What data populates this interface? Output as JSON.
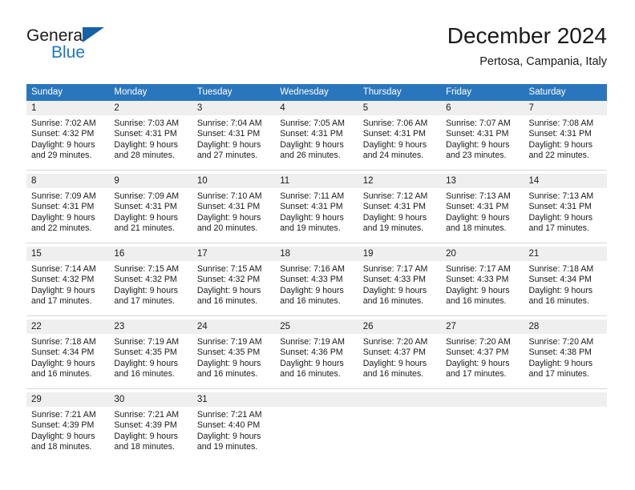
{
  "brand": {
    "line1": "General",
    "line2": "Blue",
    "triangle_icon": "brand-triangle-icon",
    "color_dark": "#1a1a1a",
    "color_blue": "#1f77c4"
  },
  "header": {
    "title": "December 2024",
    "subtitle": "Pertosa, Campania, Italy"
  },
  "colors": {
    "header_row": "#2a76bc",
    "date_strip": "#efefef",
    "cell_body": "#ffffff",
    "text": "#1a1a1a",
    "divider": "#d8d8d8"
  },
  "weekdays": [
    "Sunday",
    "Monday",
    "Tuesday",
    "Wednesday",
    "Thursday",
    "Friday",
    "Saturday"
  ],
  "weeks": [
    [
      {
        "day": "1",
        "sunrise": "Sunrise: 7:02 AM",
        "sunset": "Sunset: 4:32 PM",
        "daylight1": "Daylight: 9 hours",
        "daylight2": "and 29 minutes."
      },
      {
        "day": "2",
        "sunrise": "Sunrise: 7:03 AM",
        "sunset": "Sunset: 4:31 PM",
        "daylight1": "Daylight: 9 hours",
        "daylight2": "and 28 minutes."
      },
      {
        "day": "3",
        "sunrise": "Sunrise: 7:04 AM",
        "sunset": "Sunset: 4:31 PM",
        "daylight1": "Daylight: 9 hours",
        "daylight2": "and 27 minutes."
      },
      {
        "day": "4",
        "sunrise": "Sunrise: 7:05 AM",
        "sunset": "Sunset: 4:31 PM",
        "daylight1": "Daylight: 9 hours",
        "daylight2": "and 26 minutes."
      },
      {
        "day": "5",
        "sunrise": "Sunrise: 7:06 AM",
        "sunset": "Sunset: 4:31 PM",
        "daylight1": "Daylight: 9 hours",
        "daylight2": "and 24 minutes."
      },
      {
        "day": "6",
        "sunrise": "Sunrise: 7:07 AM",
        "sunset": "Sunset: 4:31 PM",
        "daylight1": "Daylight: 9 hours",
        "daylight2": "and 23 minutes."
      },
      {
        "day": "7",
        "sunrise": "Sunrise: 7:08 AM",
        "sunset": "Sunset: 4:31 PM",
        "daylight1": "Daylight: 9 hours",
        "daylight2": "and 22 minutes."
      }
    ],
    [
      {
        "day": "8",
        "sunrise": "Sunrise: 7:09 AM",
        "sunset": "Sunset: 4:31 PM",
        "daylight1": "Daylight: 9 hours",
        "daylight2": "and 22 minutes."
      },
      {
        "day": "9",
        "sunrise": "Sunrise: 7:09 AM",
        "sunset": "Sunset: 4:31 PM",
        "daylight1": "Daylight: 9 hours",
        "daylight2": "and 21 minutes."
      },
      {
        "day": "10",
        "sunrise": "Sunrise: 7:10 AM",
        "sunset": "Sunset: 4:31 PM",
        "daylight1": "Daylight: 9 hours",
        "daylight2": "and 20 minutes."
      },
      {
        "day": "11",
        "sunrise": "Sunrise: 7:11 AM",
        "sunset": "Sunset: 4:31 PM",
        "daylight1": "Daylight: 9 hours",
        "daylight2": "and 19 minutes."
      },
      {
        "day": "12",
        "sunrise": "Sunrise: 7:12 AM",
        "sunset": "Sunset: 4:31 PM",
        "daylight1": "Daylight: 9 hours",
        "daylight2": "and 19 minutes."
      },
      {
        "day": "13",
        "sunrise": "Sunrise: 7:13 AM",
        "sunset": "Sunset: 4:31 PM",
        "daylight1": "Daylight: 9 hours",
        "daylight2": "and 18 minutes."
      },
      {
        "day": "14",
        "sunrise": "Sunrise: 7:13 AM",
        "sunset": "Sunset: 4:31 PM",
        "daylight1": "Daylight: 9 hours",
        "daylight2": "and 17 minutes."
      }
    ],
    [
      {
        "day": "15",
        "sunrise": "Sunrise: 7:14 AM",
        "sunset": "Sunset: 4:32 PM",
        "daylight1": "Daylight: 9 hours",
        "daylight2": "and 17 minutes."
      },
      {
        "day": "16",
        "sunrise": "Sunrise: 7:15 AM",
        "sunset": "Sunset: 4:32 PM",
        "daylight1": "Daylight: 9 hours",
        "daylight2": "and 17 minutes."
      },
      {
        "day": "17",
        "sunrise": "Sunrise: 7:15 AM",
        "sunset": "Sunset: 4:32 PM",
        "daylight1": "Daylight: 9 hours",
        "daylight2": "and 16 minutes."
      },
      {
        "day": "18",
        "sunrise": "Sunrise: 7:16 AM",
        "sunset": "Sunset: 4:33 PM",
        "daylight1": "Daylight: 9 hours",
        "daylight2": "and 16 minutes."
      },
      {
        "day": "19",
        "sunrise": "Sunrise: 7:17 AM",
        "sunset": "Sunset: 4:33 PM",
        "daylight1": "Daylight: 9 hours",
        "daylight2": "and 16 minutes."
      },
      {
        "day": "20",
        "sunrise": "Sunrise: 7:17 AM",
        "sunset": "Sunset: 4:33 PM",
        "daylight1": "Daylight: 9 hours",
        "daylight2": "and 16 minutes."
      },
      {
        "day": "21",
        "sunrise": "Sunrise: 7:18 AM",
        "sunset": "Sunset: 4:34 PM",
        "daylight1": "Daylight: 9 hours",
        "daylight2": "and 16 minutes."
      }
    ],
    [
      {
        "day": "22",
        "sunrise": "Sunrise: 7:18 AM",
        "sunset": "Sunset: 4:34 PM",
        "daylight1": "Daylight: 9 hours",
        "daylight2": "and 16 minutes."
      },
      {
        "day": "23",
        "sunrise": "Sunrise: 7:19 AM",
        "sunset": "Sunset: 4:35 PM",
        "daylight1": "Daylight: 9 hours",
        "daylight2": "and 16 minutes."
      },
      {
        "day": "24",
        "sunrise": "Sunrise: 7:19 AM",
        "sunset": "Sunset: 4:35 PM",
        "daylight1": "Daylight: 9 hours",
        "daylight2": "and 16 minutes."
      },
      {
        "day": "25",
        "sunrise": "Sunrise: 7:19 AM",
        "sunset": "Sunset: 4:36 PM",
        "daylight1": "Daylight: 9 hours",
        "daylight2": "and 16 minutes."
      },
      {
        "day": "26",
        "sunrise": "Sunrise: 7:20 AM",
        "sunset": "Sunset: 4:37 PM",
        "daylight1": "Daylight: 9 hours",
        "daylight2": "and 16 minutes."
      },
      {
        "day": "27",
        "sunrise": "Sunrise: 7:20 AM",
        "sunset": "Sunset: 4:37 PM",
        "daylight1": "Daylight: 9 hours",
        "daylight2": "and 17 minutes."
      },
      {
        "day": "28",
        "sunrise": "Sunrise: 7:20 AM",
        "sunset": "Sunset: 4:38 PM",
        "daylight1": "Daylight: 9 hours",
        "daylight2": "and 17 minutes."
      }
    ],
    [
      {
        "day": "29",
        "sunrise": "Sunrise: 7:21 AM",
        "sunset": "Sunset: 4:39 PM",
        "daylight1": "Daylight: 9 hours",
        "daylight2": "and 18 minutes."
      },
      {
        "day": "30",
        "sunrise": "Sunrise: 7:21 AM",
        "sunset": "Sunset: 4:39 PM",
        "daylight1": "Daylight: 9 hours",
        "daylight2": "and 18 minutes."
      },
      {
        "day": "31",
        "sunrise": "Sunrise: 7:21 AM",
        "sunset": "Sunset: 4:40 PM",
        "daylight1": "Daylight: 9 hours",
        "daylight2": "and 19 minutes."
      },
      {
        "day": "",
        "sunrise": "",
        "sunset": "",
        "daylight1": "",
        "daylight2": ""
      },
      {
        "day": "",
        "sunrise": "",
        "sunset": "",
        "daylight1": "",
        "daylight2": ""
      },
      {
        "day": "",
        "sunrise": "",
        "sunset": "",
        "daylight1": "",
        "daylight2": ""
      },
      {
        "day": "",
        "sunrise": "",
        "sunset": "",
        "daylight1": "",
        "daylight2": ""
      }
    ]
  ]
}
